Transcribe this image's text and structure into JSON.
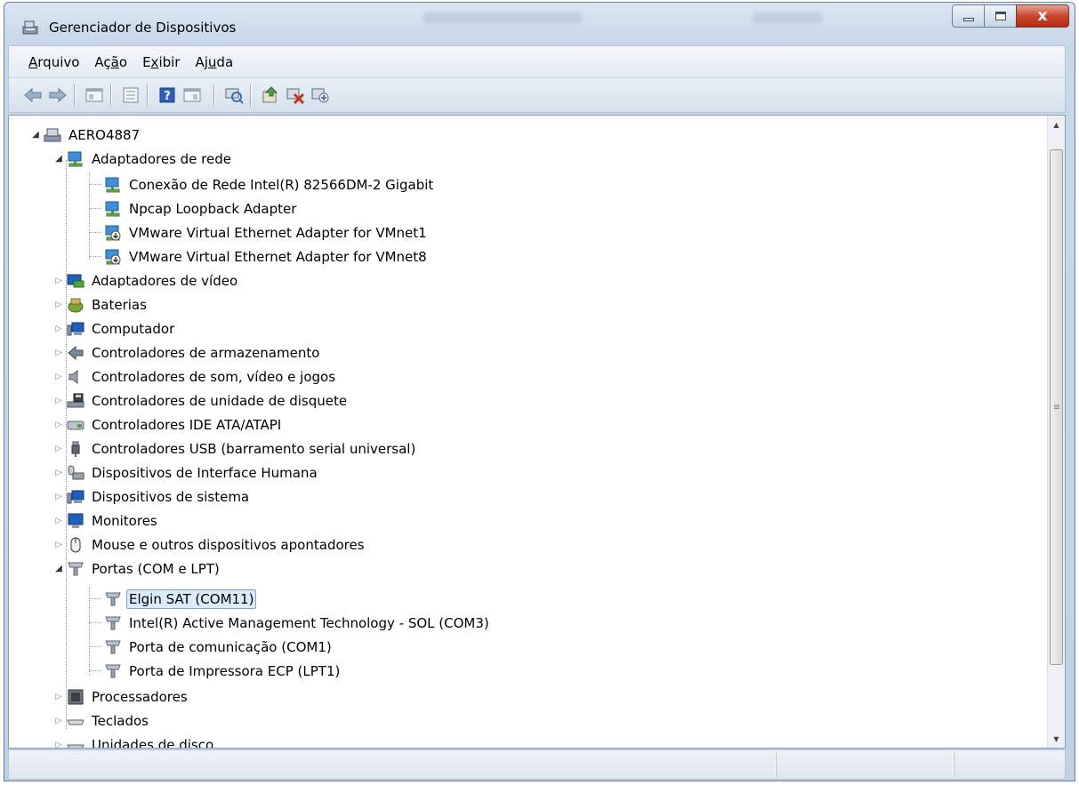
{
  "window": {
    "title": "Gerenciador de Dispositivos",
    "close_glyph": "x"
  },
  "menu": [
    {
      "pre": "",
      "acc": "A",
      "post": "rquivo"
    },
    {
      "pre": "Aç",
      "acc": "ã",
      "post": "o"
    },
    {
      "pre": "E",
      "acc": "x",
      "post": "ibir"
    },
    {
      "pre": "Aj",
      "acc": "u",
      "post": "da"
    }
  ],
  "toolbar_icons": [
    "back-icon",
    "forward-icon",
    "properties-view-icon",
    "show-hide-icon",
    "help-icon",
    "console-tree-icon",
    "scan-hardware-icon",
    "update-driver-icon",
    "uninstall-icon",
    "disable-icon"
  ],
  "tree": {
    "root": "AERO4887",
    "network_adapters": {
      "label": "Adaptadores de rede",
      "children": [
        "Conexão de Rede Intel(R) 82566DM-2 Gigabit",
        "Npcap Loopback Adapter",
        "VMware Virtual Ethernet Adapter for VMnet1",
        "VMware Virtual Ethernet Adapter for VMnet8"
      ]
    },
    "categories_a": [
      {
        "label": "Adaptadores de vídeo",
        "icon": "display-adapter-icon"
      },
      {
        "label": "Baterias",
        "icon": "battery-icon"
      },
      {
        "label": "Computador",
        "icon": "computer-icon"
      },
      {
        "label": "Controladores de armazenamento",
        "icon": "storage-controller-icon"
      },
      {
        "label": "Controladores de som, vídeo e jogos",
        "icon": "sound-icon"
      },
      {
        "label": "Controladores de unidade de disquete",
        "icon": "floppy-controller-icon"
      },
      {
        "label": "Controladores IDE ATA/ATAPI",
        "icon": "ide-controller-icon"
      },
      {
        "label": "Controladores USB (barramento serial universal)",
        "icon": "usb-icon"
      },
      {
        "label": "Dispositivos de Interface Humana",
        "icon": "hid-icon"
      },
      {
        "label": "Dispositivos de sistema",
        "icon": "system-device-icon"
      },
      {
        "label": "Monitores",
        "icon": "monitor-icon"
      },
      {
        "label": "Mouse e outros dispositivos apontadores",
        "icon": "mouse-icon"
      }
    ],
    "ports": {
      "label": "Portas (COM e LPT)",
      "children": [
        "Elgin SAT (COM11)",
        "Intel(R) Active Management Technology - SOL (COM3)",
        "Porta de comunicação (COM1)",
        "Porta de Impressora ECP (LPT1)"
      ]
    },
    "categories_b": [
      {
        "label": "Processadores",
        "icon": "processor-icon"
      },
      {
        "label": "Teclados",
        "icon": "keyboard-icon"
      },
      {
        "label": "Unidades de disco",
        "icon": "disk-drive-icon"
      }
    ]
  },
  "colors": {
    "selection_bg": "#dcebfc",
    "selection_border": "#7da2ce",
    "close_button": "#c7462d"
  }
}
